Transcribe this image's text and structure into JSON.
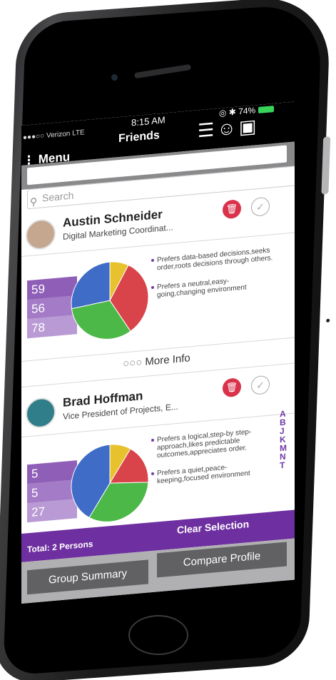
{
  "status": {
    "carrier": "●●●○○ Verizon  LTE",
    "time": "8:15 AM",
    "battery": "74%"
  },
  "header": {
    "menu_label": "⋮ Menu",
    "title": "Friends"
  },
  "search": {
    "placeholder": "Search"
  },
  "friends": [
    {
      "name": "Austin Schneider",
      "title": "Digital Marketing Coordinat...",
      "scores": [
        "59",
        "56",
        "78"
      ],
      "traits": [
        "Prefers data-based decisions,seeks order,roots decisions through others.",
        "Prefers a neutral,easy-going,changing environment"
      ],
      "pie": [
        {
          "value": 8,
          "color": "#e8c22e"
        },
        {
          "value": 33,
          "color": "#d9434a"
        },
        {
          "value": 32,
          "color": "#4cb848"
        },
        {
          "value": 27,
          "color": "#3e6cc6"
        }
      ]
    },
    {
      "name": "Brad Hoffman",
      "title": "Vice President of Projects, E...",
      "scores": [
        "5",
        "5",
        "27"
      ],
      "traits": [
        "Prefers a logical,step-by step-approach,likes predictable outcomes,appreciates order.",
        "Prefers a quiet,peace-keeping,focused environment"
      ],
      "pie": [
        {
          "value": 9,
          "color": "#e8c22e"
        },
        {
          "value": 17,
          "color": "#d9434a"
        },
        {
          "value": 33,
          "color": "#4cb848"
        },
        {
          "value": 41,
          "color": "#3e6cc6"
        }
      ]
    }
  ],
  "more_info": "More Info",
  "alphabet": [
    "A",
    "B",
    "J",
    "K",
    "M",
    "N",
    "T"
  ],
  "footer": {
    "total": "Total: 2 Persons",
    "clear": "Clear Selection"
  },
  "buttons": {
    "group": "Group Summary",
    "compare": "Compare Profile"
  }
}
